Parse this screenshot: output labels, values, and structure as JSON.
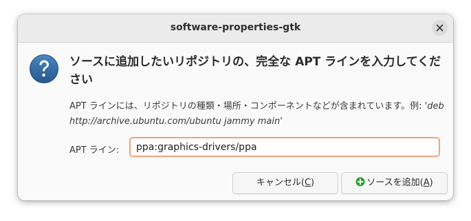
{
  "window": {
    "title": "software-properties-gtk"
  },
  "dialog": {
    "heading": "ソースに追加したいリポジトリの、完全な APT ラインを入力してください",
    "description_prefix": "APT ラインには、リポジトリの種類・場所・コンポーネントなどが含まれています。例: '",
    "description_example": "deb http://archive.ubuntu.com/ubuntu jammy main",
    "description_suffix": "'",
    "apt_line_label": "APT ライン:",
    "apt_line_value": "ppa:graphics-drivers/ppa"
  },
  "buttons": {
    "cancel_label": "キャンセル(",
    "cancel_mnemonic": "C",
    "cancel_close": ")",
    "add_label": "ソースを追加(",
    "add_mnemonic": "A",
    "add_close": ")"
  },
  "icons": {
    "close": "close-icon",
    "question": "question-icon",
    "add": "plus-circle-icon"
  },
  "colors": {
    "input_focus_border": "#f0a27e",
    "question_icon": "#2f6aa3",
    "add_icon": "#2ca02c"
  }
}
